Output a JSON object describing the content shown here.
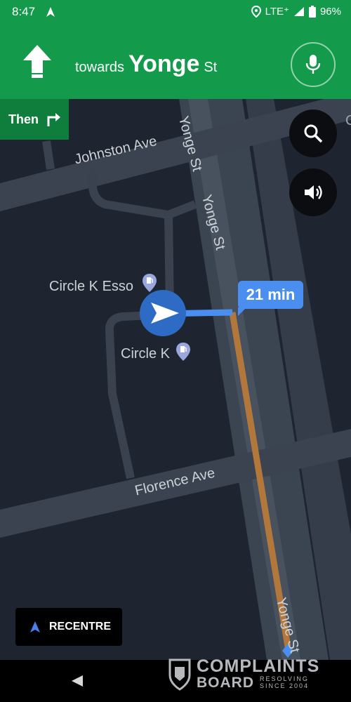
{
  "status_bar": {
    "time": "8:47",
    "network": "LTE⁺",
    "battery": "96%"
  },
  "banner": {
    "towards": "towards",
    "street": "Yonge",
    "suffix": "St",
    "then_label": "Then"
  },
  "map": {
    "labels": {
      "johnston": "Johnston Ave",
      "yonge_top1": "Yonge St",
      "yonge_top2": "Yonge St",
      "yonge_bottom": "Yonge St",
      "florence": "Florence Ave",
      "circle_k_esso": "Circle K Esso",
      "circle_k": "Circle K"
    },
    "eta": "21 min",
    "icons": {
      "search": "search-icon",
      "volume": "volume-icon",
      "fuel": "fuel-pin-icon"
    }
  },
  "recentre": {
    "label": "RECENTRE"
  },
  "watermark": {
    "line1": "COMPLAINTS",
    "line2": "BOARD",
    "small1": "RESOLVING",
    "small2": "SINCE 2004"
  },
  "colors": {
    "banner_green": "#139a4a",
    "then_green": "#0f7d3b",
    "route_blue": "#4a8ff0",
    "route_traffic": "#b2773a",
    "map_bg": "#1e2430"
  }
}
